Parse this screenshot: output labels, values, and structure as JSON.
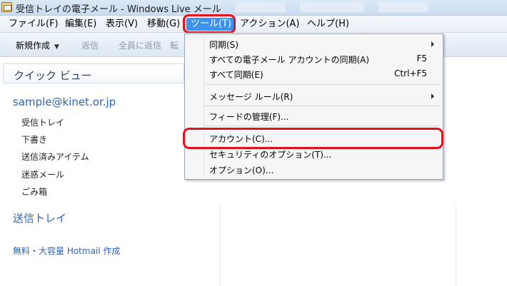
{
  "window": {
    "title": "受信トレイの電子メール - Windows Live メール"
  },
  "menubar": {
    "items": [
      {
        "label": "ファイル(F)"
      },
      {
        "label": "編集(E)"
      },
      {
        "label": "表示(V)"
      },
      {
        "label": "移動(G)"
      },
      {
        "label": "ツール(T)",
        "active": true
      },
      {
        "label": "アクション(A)"
      },
      {
        "label": "ヘルプ(H)"
      }
    ]
  },
  "toolbar": {
    "new_label": "新規作成",
    "reply_label": "返信",
    "reply_all_label": "全員に返信",
    "extra_label": "転"
  },
  "sidebar": {
    "quick_view": "クイック ビュー",
    "account": "sample@kinet.or.jp",
    "folders": [
      "受信トレイ",
      "下書き",
      "送信済みアイテム",
      "迷惑メール",
      "ごみ箱"
    ],
    "outbox": "送信トレイ",
    "hotmail_link": "無料・大容量 Hotmail 作成"
  },
  "tools_menu": {
    "items": [
      {
        "label": "同期(S)",
        "shortcut": "",
        "submenu": true
      },
      {
        "label": "すべての電子メール アカウントの同期(A)",
        "shortcut": "F5"
      },
      {
        "label": "すべて同期(E)",
        "shortcut": "Ctrl+F5"
      },
      {
        "label": "メッセージ ルール(R)",
        "shortcut": "",
        "submenu": true
      },
      {
        "label": "フィードの管理(F)...",
        "shortcut": ""
      },
      {
        "label": "アカウント(C)...",
        "shortcut": ""
      },
      {
        "label": "セキュリティのオプション(T)...",
        "shortcut": ""
      },
      {
        "label": "オプション(O)...",
        "shortcut": ""
      }
    ]
  },
  "colors": {
    "highlight": "#e2131f",
    "active_menu": "#3d93f2",
    "link": "#2a63b8"
  }
}
